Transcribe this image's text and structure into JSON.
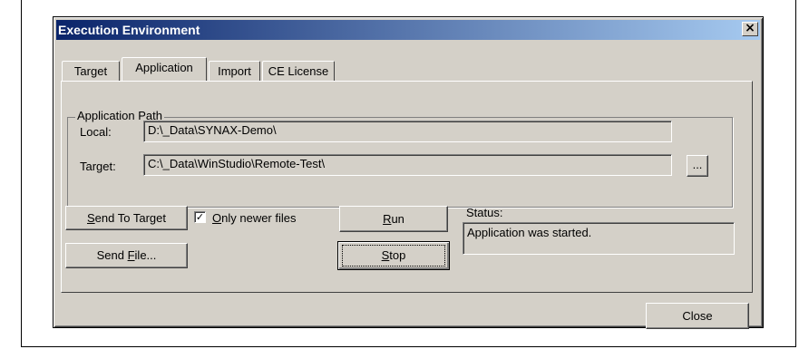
{
  "window": {
    "title": "Execution Environment",
    "close_glyph": "×"
  },
  "tabs": [
    {
      "label": "Target",
      "active": false
    },
    {
      "label": "Application",
      "active": true
    },
    {
      "label": "Import",
      "active": false
    },
    {
      "label": "CE License",
      "active": false
    }
  ],
  "app_path": {
    "group_label": "Application Path",
    "local_label": "Local:",
    "local_value": "D:\\_Data\\SYNAX-Demo\\",
    "target_label": "Target:",
    "target_value": "C:\\_Data\\WinStudio\\Remote-Test\\",
    "browse_label": "..."
  },
  "actions": {
    "send_to_target": {
      "pre": "",
      "accel": "S",
      "post": "end To Target"
    },
    "only_newer": {
      "pre": "",
      "accel": "O",
      "post": "nly newer files",
      "checked": true
    },
    "send_file": {
      "pre": "Send ",
      "accel": "F",
      "post": "ile..."
    },
    "run": {
      "pre": "",
      "accel": "R",
      "post": "un"
    },
    "stop": {
      "pre": "",
      "accel": "S",
      "post": "top"
    }
  },
  "status": {
    "label": "Status:",
    "value": "Application was started."
  },
  "footer": {
    "close_label": "Close"
  }
}
